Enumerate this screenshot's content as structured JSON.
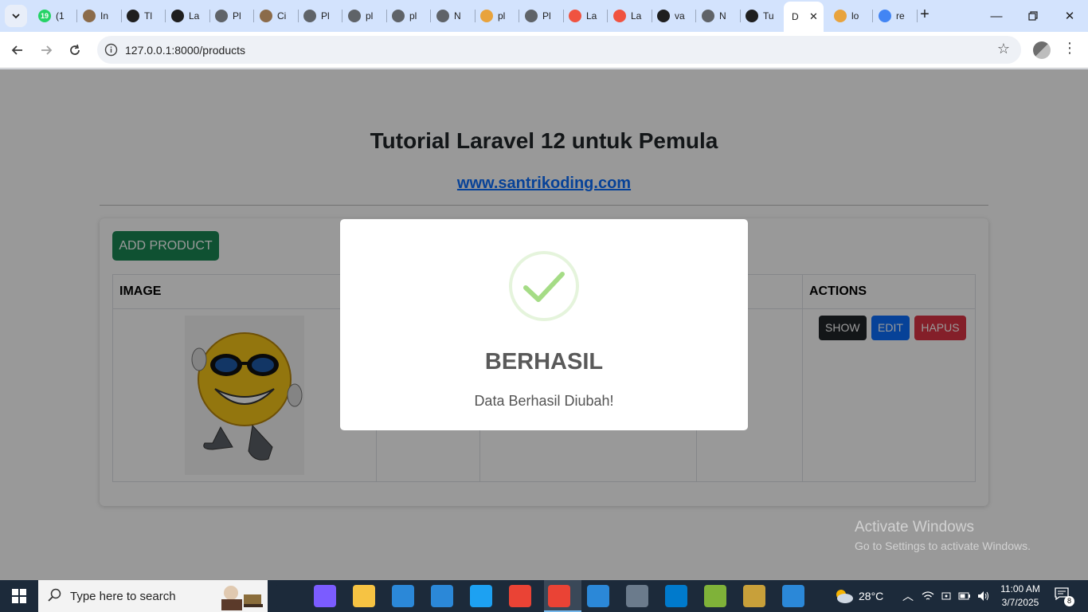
{
  "browser": {
    "active_tab_label": "D",
    "tabs": [
      {
        "label": "(1",
        "icon": "whatsapp-icon",
        "badge": "19",
        "color": "#25d366"
      },
      {
        "label": "In",
        "icon": "avatar-icon",
        "color": "#8b6b4a"
      },
      {
        "label": "Tl",
        "icon": "github-icon",
        "color": "#1f1f1f"
      },
      {
        "label": "La",
        "icon": "openai-icon",
        "color": "#1f1f1f"
      },
      {
        "label": "Pl",
        "icon": "globe-icon",
        "color": "#5f6368"
      },
      {
        "label": "Ci",
        "icon": "avatar-icon",
        "color": "#8b6b4a"
      },
      {
        "label": "Pl",
        "icon": "globe-icon",
        "color": "#5f6368"
      },
      {
        "label": "pl",
        "icon": "globe-icon",
        "color": "#5f6368"
      },
      {
        "label": "pl",
        "icon": "globe-icon",
        "color": "#5f6368"
      },
      {
        "label": "N",
        "icon": "chrome-offline-icon",
        "color": "#5f6368"
      },
      {
        "label": "pl",
        "icon": "phpmyadmin-icon",
        "color": "#e8a33d"
      },
      {
        "label": "Pl",
        "icon": "globe-icon",
        "color": "#5f6368"
      },
      {
        "label": "La",
        "icon": "laravel-icon",
        "color": "#f05340"
      },
      {
        "label": "La",
        "icon": "laravel-icon",
        "color": "#f05340"
      },
      {
        "label": "va",
        "icon": "github-icon",
        "color": "#1f1f1f"
      },
      {
        "label": "N",
        "icon": "chrome-offline-icon",
        "color": "#5f6368"
      },
      {
        "label": "Tu",
        "icon": "helmet-icon",
        "color": "#1f1f1f"
      },
      {
        "label": "lo",
        "icon": "phpmyadmin-icon",
        "color": "#e8a33d"
      },
      {
        "label": "re",
        "icon": "google-icon",
        "color": "#4285f4"
      }
    ],
    "url": "127.0.0.1:8000/products"
  },
  "page": {
    "title": "Tutorial Laravel 12 untuk Pemula",
    "site_link": "www.santrikoding.com",
    "add_button": "ADD PRODUCT",
    "table": {
      "headers": [
        "IMAGE",
        "",
        "",
        "",
        "ACTIONS"
      ],
      "row": {
        "image_alt": "product-image",
        "actions": {
          "show": "SHOW",
          "edit": "EDIT",
          "delete": "HAPUS"
        }
      }
    }
  },
  "modal": {
    "title": "BERHASIL",
    "text": "Data Berhasil Diubah!",
    "icon": "success-check-icon"
  },
  "watermark": {
    "line1": "Activate Windows",
    "line2": "Go to Settings to activate Windows."
  },
  "taskbar": {
    "search_placeholder": "Type here to search",
    "weather": "28°C",
    "time": "11:00 AM",
    "date": "3/7/2025",
    "notification_count": "8",
    "apps": [
      {
        "name": "task-view-icon",
        "color": "#1c2a3a"
      },
      {
        "name": "copilot-icon",
        "color": "#7b5cff"
      },
      {
        "name": "file-explorer-icon",
        "color": "#f6c343"
      },
      {
        "name": "mail-icon",
        "color": "#2b88d8"
      },
      {
        "name": "store-icon",
        "color": "#2b88d8"
      },
      {
        "name": "edge-icon",
        "color": "#1da1f2"
      },
      {
        "name": "chrome-icon",
        "color": "#ea4335"
      },
      {
        "name": "chrome-active-icon",
        "color": "#ea4335"
      },
      {
        "name": "app-icon",
        "color": "#2b88d8"
      },
      {
        "name": "remote-desktop-icon",
        "color": "#6b7b8c"
      },
      {
        "name": "vscode-icon",
        "color": "#007acc"
      },
      {
        "name": "notepad-plus-icon",
        "color": "#7fb239"
      },
      {
        "name": "git-icon",
        "color": "#c8a03a"
      },
      {
        "name": "photos-icon",
        "color": "#2b88d8"
      }
    ]
  }
}
